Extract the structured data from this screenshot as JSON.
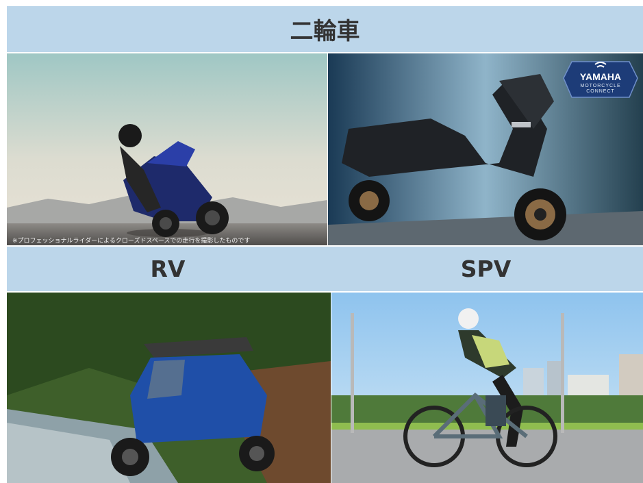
{
  "banners": {
    "motorcycle": "二輪車",
    "rv": "RV",
    "spv": "SPV"
  },
  "sport_photo": {
    "disclaimer": "※プロフェッショナルライダーによるクローズドスペースでの走行を撮影したものです"
  },
  "scooter_photo": {
    "badge_brand": "YAMAHA",
    "badge_line1": "MOTORCYCLE",
    "badge_line2": "CONNECT"
  },
  "colors": {
    "banner_bg": "#bcd6ea",
    "banner_text": "#333333"
  }
}
